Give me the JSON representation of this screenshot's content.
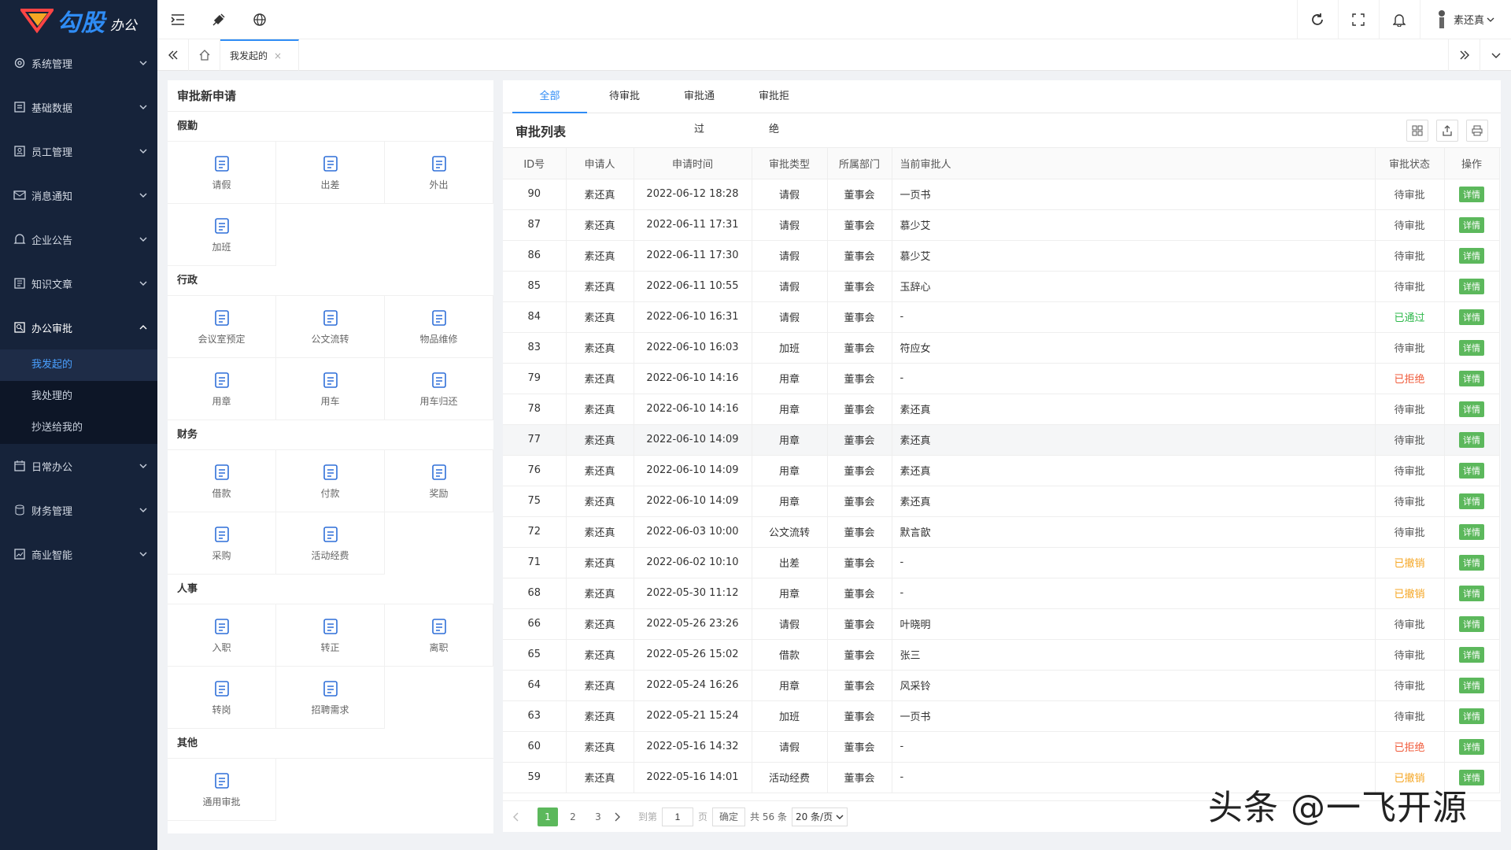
{
  "brand": {
    "name": "勾股",
    "suffix": "办公",
    "logo_small": "OA"
  },
  "sidebar": {
    "items": [
      {
        "label": "系统管理",
        "icon": "gear-icon"
      },
      {
        "label": "基础数据",
        "icon": "database-icon"
      },
      {
        "label": "员工管理",
        "icon": "user-card-icon"
      },
      {
        "label": "消息通知",
        "icon": "message-icon"
      },
      {
        "label": "企业公告",
        "icon": "bell-icon"
      },
      {
        "label": "知识文章",
        "icon": "article-icon"
      },
      {
        "label": "办公审批",
        "icon": "approval-icon"
      },
      {
        "label": "日常办公",
        "icon": "calendar-icon"
      },
      {
        "label": "财务管理",
        "icon": "finance-icon"
      },
      {
        "label": "商业智能",
        "icon": "chart-icon"
      }
    ],
    "sub": [
      "我发起的",
      "我处理的",
      "抄送给我的"
    ]
  },
  "topbar": {
    "user": "素还真"
  },
  "tabs": {
    "current": "我发起的",
    "close": "×"
  },
  "left": {
    "title": "审批新申请",
    "groups": [
      {
        "name": "假勤",
        "items": [
          "请假",
          "出差",
          "外出",
          "加班"
        ]
      },
      {
        "name": "行政",
        "items": [
          "会议室预定",
          "公文流转",
          "物品维修",
          "用章",
          "用车",
          "用车归还"
        ]
      },
      {
        "name": "财务",
        "items": [
          "借款",
          "付款",
          "奖励",
          "采购",
          "活动经费"
        ]
      },
      {
        "name": "人事",
        "items": [
          "入职",
          "转正",
          "离职",
          "转岗",
          "招聘需求"
        ]
      },
      {
        "name": "其他",
        "items": [
          "通用审批"
        ]
      }
    ]
  },
  "right": {
    "tabs": [
      "全部",
      "待审批",
      "审批通过",
      "审批拒绝"
    ],
    "list_title": "审批列表",
    "columns": [
      "ID号",
      "申请人",
      "申请时间",
      "审批类型",
      "所属部门",
      "当前审批人",
      "审批状态",
      "操作"
    ],
    "detail_label": "详情",
    "rows": [
      [
        "90",
        "素还真",
        "2022-06-12 18:28",
        "请假",
        "董事会",
        "一页书",
        "待审批"
      ],
      [
        "87",
        "素还真",
        "2022-06-11 17:31",
        "请假",
        "董事会",
        "慕少艾",
        "待审批"
      ],
      [
        "86",
        "素还真",
        "2022-06-11 17:30",
        "请假",
        "董事会",
        "慕少艾",
        "待审批"
      ],
      [
        "85",
        "素还真",
        "2022-06-11 10:55",
        "请假",
        "董事会",
        "玉辞心",
        "待审批"
      ],
      [
        "84",
        "素还真",
        "2022-06-10 16:31",
        "请假",
        "董事会",
        "-",
        "已通过"
      ],
      [
        "83",
        "素还真",
        "2022-06-10 16:03",
        "加班",
        "董事会",
        "符应女",
        "待审批"
      ],
      [
        "79",
        "素还真",
        "2022-06-10 14:16",
        "用章",
        "董事会",
        "-",
        "已拒绝"
      ],
      [
        "78",
        "素还真",
        "2022-06-10 14:16",
        "用章",
        "董事会",
        "素还真",
        "待审批"
      ],
      [
        "77",
        "素还真",
        "2022-06-10 14:09",
        "用章",
        "董事会",
        "素还真",
        "待审批"
      ],
      [
        "76",
        "素还真",
        "2022-06-10 14:09",
        "用章",
        "董事会",
        "素还真",
        "待审批"
      ],
      [
        "75",
        "素还真",
        "2022-06-10 14:09",
        "用章",
        "董事会",
        "素还真",
        "待审批"
      ],
      [
        "72",
        "素还真",
        "2022-06-03 10:00",
        "公文流转",
        "董事会",
        "默言歆",
        "待审批"
      ],
      [
        "71",
        "素还真",
        "2022-06-02 10:10",
        "出差",
        "董事会",
        "-",
        "已撤销"
      ],
      [
        "68",
        "素还真",
        "2022-05-30 11:12",
        "用章",
        "董事会",
        "-",
        "已撤销"
      ],
      [
        "66",
        "素还真",
        "2022-05-26 23:26",
        "请假",
        "董事会",
        "叶晓明",
        "待审批"
      ],
      [
        "65",
        "素还真",
        "2022-05-26 15:02",
        "借款",
        "董事会",
        "张三",
        "待审批"
      ],
      [
        "64",
        "素还真",
        "2022-05-24 16:26",
        "用章",
        "董事会",
        "风采铃",
        "待审批"
      ],
      [
        "63",
        "素还真",
        "2022-05-21 15:24",
        "加班",
        "董事会",
        "一页书",
        "待审批"
      ],
      [
        "60",
        "素还真",
        "2022-05-16 14:32",
        "请假",
        "董事会",
        "-",
        "已拒绝"
      ],
      [
        "59",
        "素还真",
        "2022-05-16 14:01",
        "活动经费",
        "董事会",
        "-",
        "已撤销"
      ]
    ],
    "status_colors": {
      "待审批": "#555555",
      "已通过": "#2eb84b",
      "已拒绝": "#f05a3a",
      "已撤销": "#f5a623"
    }
  },
  "pager": {
    "pages": [
      "1",
      "2",
      "3"
    ],
    "goto_label": "到第",
    "goto_value": "1",
    "page_unit": "页",
    "confirm": "确定",
    "total": "共 56 条",
    "per_page": "20 条/页"
  },
  "watermark": "头条 @一飞开源"
}
